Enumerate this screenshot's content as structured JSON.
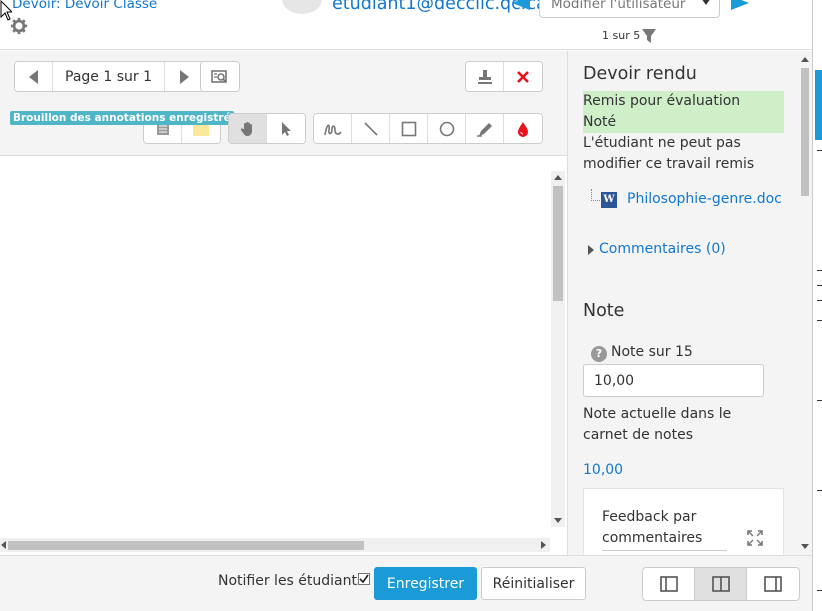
{
  "header": {
    "assignment_link": "Devoir: Devoir Classe",
    "user_email": "etudiant1@decclic.qc.ca",
    "user_select_placeholder": "Modifier l'utilisateur",
    "count_label": "1 sur 5"
  },
  "toolbar": {
    "page_label": "Page 1 sur 1",
    "draft_badge": "Brouillon des annotations enregistré",
    "colors": {
      "stamp_red": "#e8111c",
      "ink_red": "#e8111c",
      "note_yellow": "#fce89a"
    }
  },
  "panel": {
    "submission_title": "Devoir rendu",
    "status_submitted": "Remis pour évaluation",
    "status_graded": "Noté",
    "locked_text": "L'étudiant ne peut pas modifier ce travail remis",
    "file_name": "Philosophie-genre.doc",
    "comments_link": "Commentaires (0)",
    "grade_title": "Note",
    "grade_label": "Note sur 15",
    "grade_value": "10,00",
    "current_grade_label": "Note actuelle dans le carnet de notes",
    "current_grade_value": "10,00",
    "feedback_label": "Feedback par commentaires"
  },
  "footer": {
    "notify_label": "Notifier les étudiants",
    "save_label": "Enregistrer",
    "reset_label": "Réinitialiser"
  }
}
